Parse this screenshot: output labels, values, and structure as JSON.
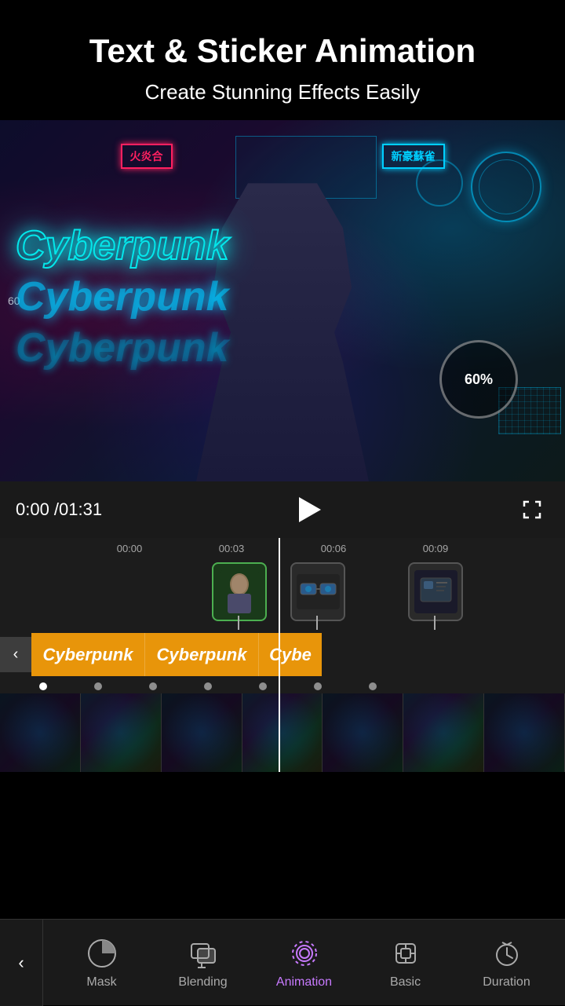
{
  "header": {
    "title": "Text & Sticker Animation",
    "subtitle": "Create Stunning Effects Easily"
  },
  "video": {
    "cyber_text_1": "Cyberpunk",
    "cyber_text_2": "Cyberpunk",
    "cyber_text_3": "Cyberpunk",
    "percent_label": "60%",
    "timestamp_left": "60"
  },
  "playback": {
    "time_current": "0:00",
    "time_total": "/01:31",
    "time_display": "0:00 /01:31"
  },
  "timeline": {
    "ruler_marks": [
      "00:00",
      "00:03",
      "00:06",
      "00:09"
    ],
    "text_blocks": [
      "Cyberpunk",
      "Cyberpunk",
      "Cybe"
    ]
  },
  "toolbar": {
    "back_label": "‹",
    "items": [
      {
        "id": "mask",
        "label": "Mask",
        "active": false
      },
      {
        "id": "blending",
        "label": "Blending",
        "active": false
      },
      {
        "id": "animation",
        "label": "Animation",
        "active": true
      },
      {
        "id": "basic",
        "label": "Basic",
        "active": false
      },
      {
        "id": "duration",
        "label": "Duration",
        "active": false
      }
    ]
  },
  "colors": {
    "accent_purple": "#c87aff",
    "orange_track": "#e8950a",
    "neon_cyan": "#00ffff",
    "active_green": "#4caf50"
  }
}
